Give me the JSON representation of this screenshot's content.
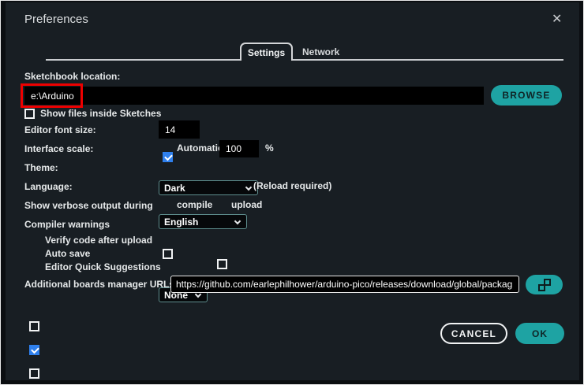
{
  "window": {
    "title": "Preferences"
  },
  "icons": {
    "close": "✕"
  },
  "tabs": {
    "settings": "Settings",
    "network": "Network"
  },
  "form": {
    "sketchbook": {
      "label": "Sketchbook location:",
      "value": "e:\\Arduino",
      "browse": "BROWSE"
    },
    "show_files": {
      "label": "Show files inside Sketches",
      "checked": false
    },
    "font_size": {
      "label": "Editor font size:",
      "value": "14"
    },
    "interface_scale": {
      "label": "Interface scale:",
      "auto_label": "Automatic",
      "auto_checked": true,
      "value": "100",
      "unit": "%"
    },
    "theme": {
      "label": "Theme:",
      "value": "Dark"
    },
    "language": {
      "label": "Language:",
      "value": "English",
      "note": "(Reload required)"
    },
    "verbose": {
      "label": "Show verbose output during",
      "compile": "compile",
      "upload": "upload"
    },
    "warnings": {
      "label": "Compiler warnings",
      "value": "None"
    },
    "verify": {
      "label": "Verify code after upload",
      "checked": false
    },
    "autosave": {
      "label": "Auto save",
      "checked": true
    },
    "quick_suggestions": {
      "label": "Editor Quick Suggestions",
      "checked": false
    },
    "boards": {
      "label": "Additional boards manager URLs:",
      "value": "https://github.com/earlephilhower/arduino-pico/releases/download/global/packag"
    }
  },
  "actions": {
    "cancel": "CANCEL",
    "ok": "OK"
  },
  "colors": {
    "accent": "#1ea3a3",
    "checkbox_checked": "#2f80ed",
    "highlight_red": "#ee0000",
    "panel_bg": "#181e23"
  }
}
